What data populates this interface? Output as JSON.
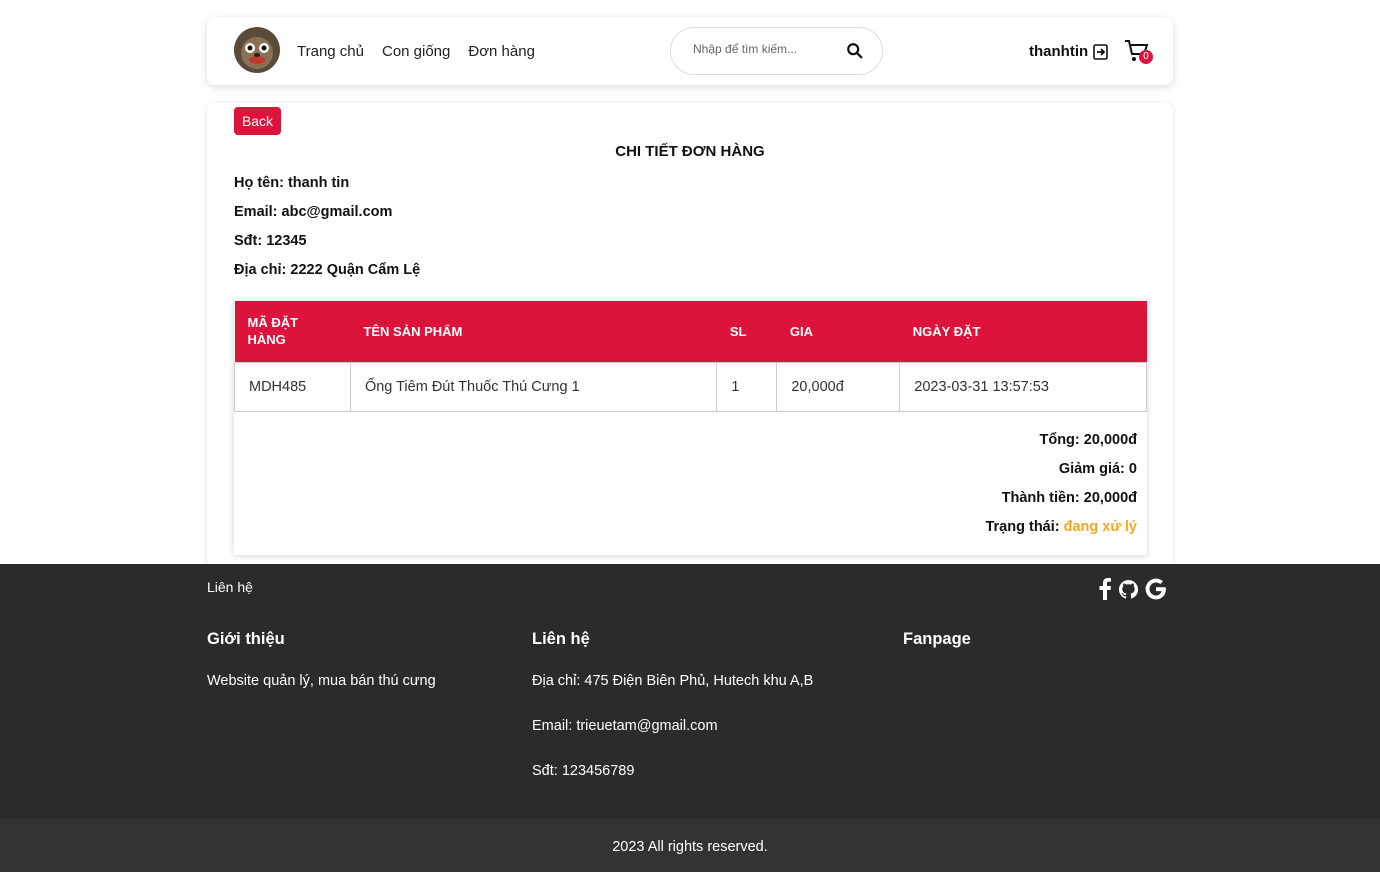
{
  "header": {
    "nav": [
      "Trang chủ",
      "Con giống",
      "Đơn hàng"
    ],
    "search_placeholder": "Nhập để tìm kiếm...",
    "username": "thanhtin",
    "cart_count": "0"
  },
  "order": {
    "back_label": "Back",
    "title": "CHI TIẾT ĐƠN HÀNG",
    "customer": {
      "name_label": "Họ tên:",
      "name": "thanh tin",
      "email_label": "Email:",
      "email": "abc@gmail.com",
      "phone_label": "Sđt:",
      "phone": "12345",
      "address_label": "Địa chỉ:",
      "address": "2222 Quận Cẩm Lệ"
    },
    "table": {
      "headers": [
        "MÃ ĐẶT HÀNG",
        "TÊN SẢN PHẨM",
        "SL",
        "GIA",
        "NGÀY ĐẶT"
      ],
      "rows": [
        [
          "MDH485",
          "Ống Tiêm Đút Thuốc Thú Cưng 1",
          "1",
          "20,000đ",
          "2023-03-31 13:57:53"
        ]
      ]
    },
    "summary": {
      "total_label": "Tổng:",
      "total": "20,000đ",
      "discount_label": "Giảm giá:",
      "discount": "0",
      "final_label": "Thành tiền:",
      "final": "20,000đ",
      "status_label": "Trạng thái:",
      "status": "đang xử lý"
    }
  },
  "footer": {
    "contact_top": "Liên hệ",
    "about_title": "Giới thiệu",
    "about_text": "Website quản lý, mua bán thú cưng",
    "contact_title": "Liên hệ",
    "address": "Địa chỉ: 475 Điện Biên Phủ, Hutech khu A,B",
    "email": "Email: trieuetam@gmail.com",
    "phone": "Sđt: 123456789",
    "fanpage_title": "Fanpage",
    "copyright": "2023 All rights reserved."
  },
  "colors": {
    "accent": "#dc143c",
    "status": "#f5a623",
    "footer_bg": "#2b2b2b"
  },
  "icons": [
    "avatar-logo",
    "search-icon",
    "logout-icon",
    "cart-icon",
    "facebook-icon",
    "github-icon",
    "google-icon"
  ]
}
